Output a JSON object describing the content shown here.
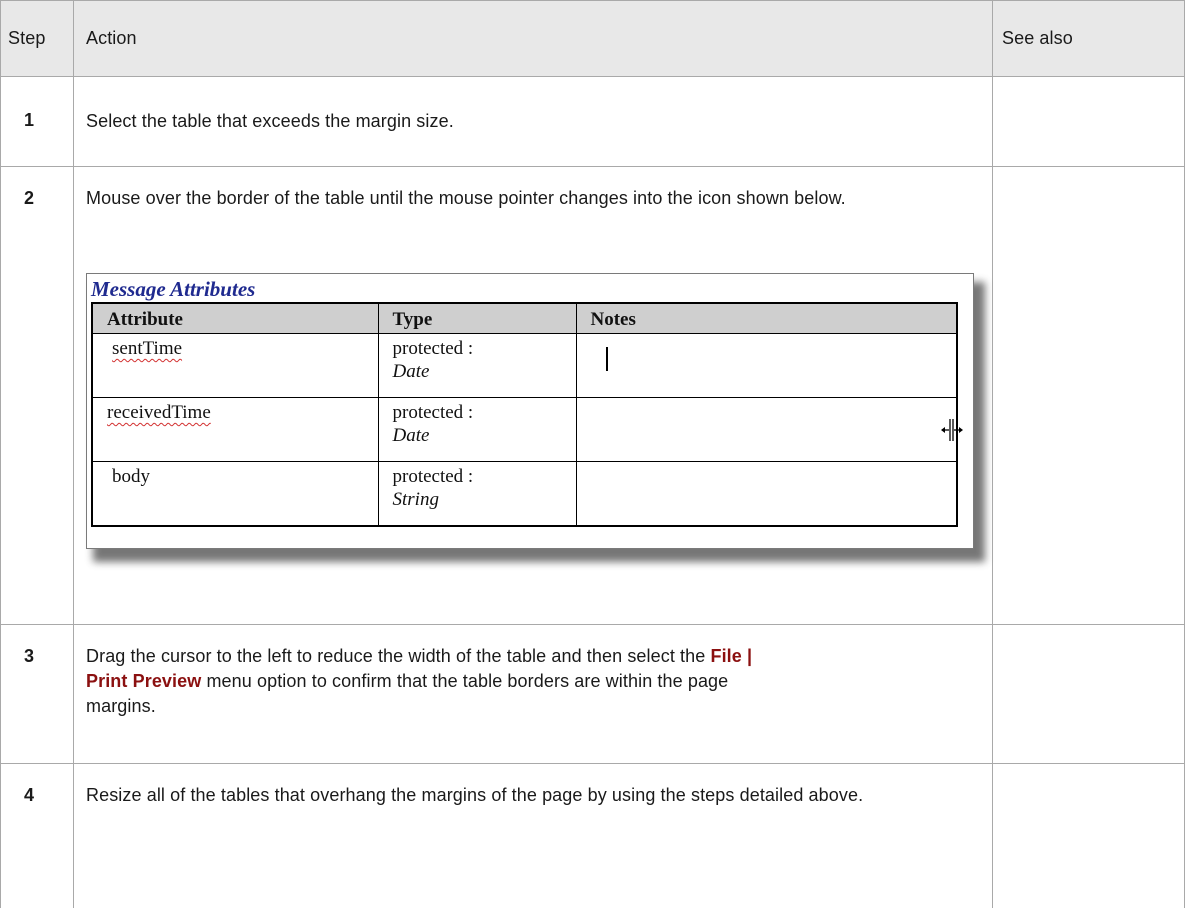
{
  "header": {
    "step": "Step",
    "action": "Action",
    "see_also": "See also"
  },
  "steps": [
    {
      "number": "1",
      "action_text": "Select the table that exceeds the margin size."
    },
    {
      "number": "2",
      "action_text": "Mouse over the border of the table until the mouse pointer changes into the icon shown below.",
      "image": {
        "title": "Message Attributes",
        "columns": [
          "Attribute",
          "Type",
          "Notes"
        ],
        "rows": [
          {
            "attribute": "sentTime",
            "type_prefix": "protected :",
            "type_name": "Date",
            "notes": ""
          },
          {
            "attribute": "receivedTime",
            "type_prefix": "protected :",
            "type_name": "Date",
            "notes": ""
          },
          {
            "attribute": "body",
            "type_prefix": "protected :",
            "type_name": "String",
            "notes": ""
          }
        ]
      }
    },
    {
      "number": "3",
      "action_before": "Drag the cursor to the left to reduce the width of the table and then select the ",
      "menu_path_line1": "File |",
      "menu_path_line2": "Print Preview",
      "action_after": " menu option to confirm that the table borders are within the page",
      "action_last": "margins."
    },
    {
      "number": "4",
      "action_text": "Resize all of the tables that overhang the margins of the page by using the steps detailed above."
    }
  ],
  "colors": {
    "header_bg": "#e8e8e8",
    "grid": "#a9a9a9",
    "menu_path": "#8b1010",
    "image_title": "#1f2a8f"
  }
}
